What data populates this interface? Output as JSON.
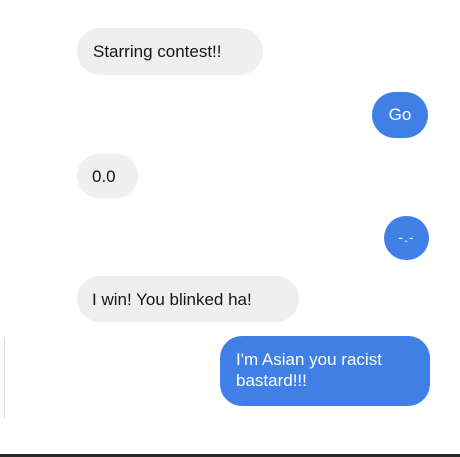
{
  "messages": [
    {
      "side": "received",
      "text": "Starring contest!!"
    },
    {
      "side": "sent",
      "text": "Go"
    },
    {
      "side": "received",
      "text": "0.0"
    },
    {
      "side": "sent",
      "text": "-.-"
    },
    {
      "side": "received",
      "text": "I win! You blinked ha!"
    },
    {
      "side": "sent",
      "text": "I'm Asian you racist\nbastard!!!"
    }
  ],
  "colors": {
    "received_bubble": "#efefef",
    "sent_bubble": "#3f7fe6",
    "received_text": "#151515",
    "sent_text": "#ffffff"
  }
}
